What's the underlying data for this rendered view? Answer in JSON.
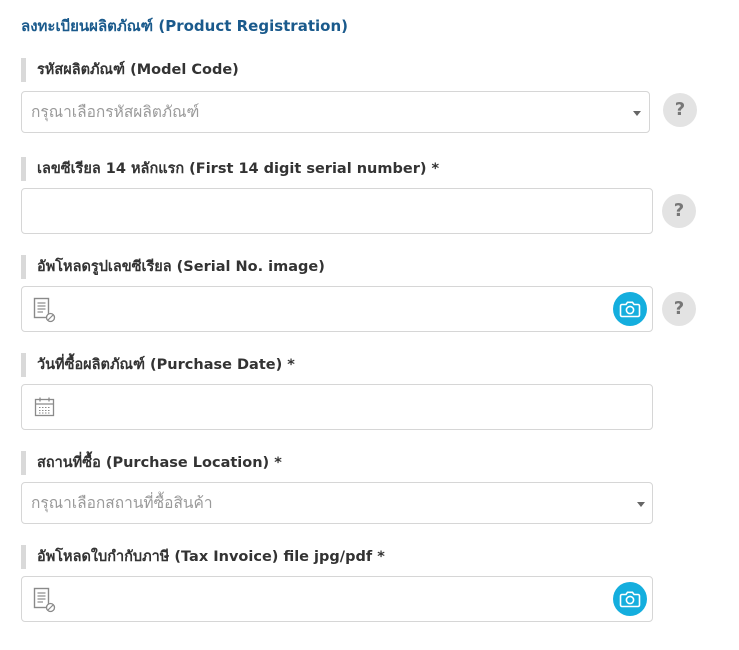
{
  "page": {
    "title": "ลงทะเบียนผลิตภัณฑ์ (Product Registration)"
  },
  "fields": {
    "model_code": {
      "label": "รหัสผลิตภัณฑ์ (Model Code)",
      "placeholder": "กรุณาเลือกรหัสผลิตภัณฑ์",
      "help": "?"
    },
    "serial_number": {
      "label": "เลขซีเรียล 14 หลักแรก (First 14 digit serial number) *",
      "value": "",
      "help": "?"
    },
    "serial_image": {
      "label": "อัพโหลดรูปเลขซีเรียล (Serial No. image)",
      "help": "?"
    },
    "purchase_date": {
      "label": "วันที่ซื้อผลิตภัณฑ์ (Purchase Date) *",
      "value": ""
    },
    "purchase_location": {
      "label": "สถานที่ซื้อ (Purchase Location) *",
      "placeholder": "กรุณาเลือกสถานที่ซื้อสินค้า"
    },
    "tax_invoice": {
      "label": "อัพโหลดใบกำกับภาษี (Tax Invoice) file jpg/pdf *"
    }
  },
  "icons": {
    "help": "question-mark-icon",
    "upload": "camera-icon",
    "file": "document-icon",
    "date": "calendar-icon",
    "dropdown": "caret-down-icon"
  },
  "colors": {
    "title": "#1a5a8c",
    "camera_button": "#14aede",
    "help_button": "#e3e3e3",
    "label_bar": "#d9d9d9",
    "border": "#d6d6d6",
    "placeholder": "#9a9a9a"
  }
}
